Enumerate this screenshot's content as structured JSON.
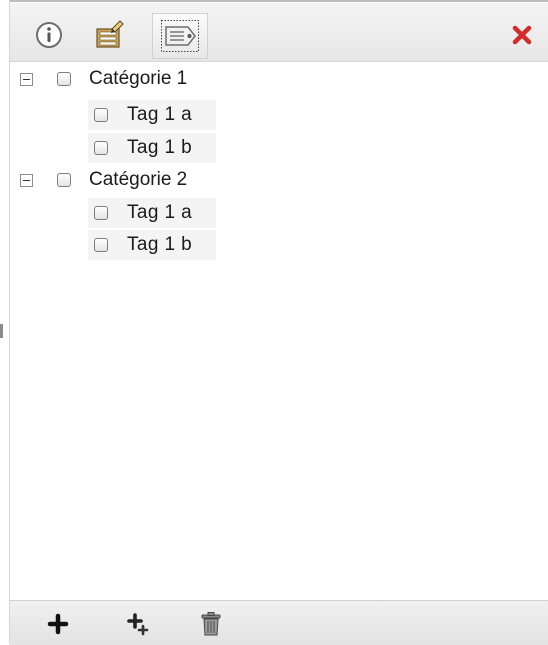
{
  "toolbar": {
    "buttons": [
      {
        "name": "info",
        "icon": "info-icon"
      },
      {
        "name": "edit",
        "icon": "edit-document-icon"
      },
      {
        "name": "tags",
        "icon": "tag-icon",
        "selected": true
      }
    ],
    "close_icon": "close-icon",
    "close_color": "#d42a2a"
  },
  "tree": {
    "categories": [
      {
        "label": "Catégorie 1",
        "expanded": true,
        "checked": false,
        "tags": [
          {
            "label": "Tag 1 a",
            "checked": false
          },
          {
            "label": "Tag 1 b",
            "checked": false
          }
        ]
      },
      {
        "label": "Catégorie 2",
        "expanded": true,
        "checked": false,
        "tags": [
          {
            "label": "Tag 1 a",
            "checked": false
          },
          {
            "label": "Tag 1 b",
            "checked": false
          }
        ]
      }
    ]
  },
  "bottom_toolbar": {
    "buttons": [
      {
        "name": "add",
        "icon": "plus-icon"
      },
      {
        "name": "add-child",
        "icon": "add-child-icon"
      },
      {
        "name": "delete",
        "icon": "trash-icon"
      }
    ]
  }
}
